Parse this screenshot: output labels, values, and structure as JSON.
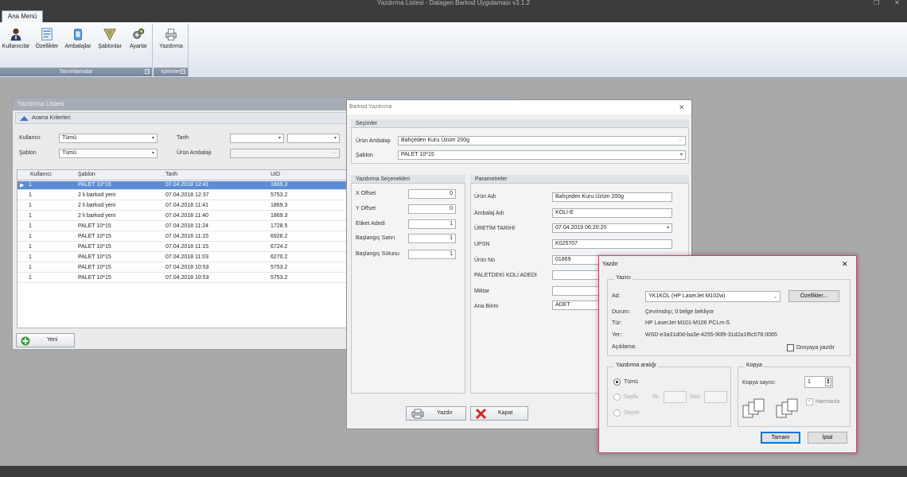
{
  "window": {
    "title": "Yazdırma Listesi - Datagen Barkod Uygulaması v3.1.2"
  },
  "ribbon": {
    "tab": "Ana Menü",
    "groups": [
      {
        "label": "Tanımlamalar",
        "buttons": [
          "Kullanıcılar",
          "Özellikler",
          "Ambalajlar",
          "Şablonlar",
          "Ayarlar"
        ]
      },
      {
        "label": "İşlemler",
        "buttons": [
          "Yazdırma"
        ]
      }
    ]
  },
  "list_window": {
    "title": "Yazdırma Listesi",
    "search_header": "Arama Kriterleri",
    "filters": {
      "kullanici_label": "Kullanıcı",
      "kullanici_value": "Tümü",
      "sablon_label": "Şablon",
      "sablon_value": "Tümü",
      "tarih_label": "Tarih",
      "urun_ambalaji_label": "Ürün Ambalajı"
    },
    "columns": [
      "Kullanıcı",
      "Şablon",
      "Tarih",
      "UID"
    ],
    "rows": [
      [
        "1",
        "PALET 10*15",
        "07.04.2018 12:41",
        "1869.3"
      ],
      [
        "1",
        "2 li barkod yeni",
        "07.04.2018 12:37",
        "5753.2"
      ],
      [
        "1",
        "2 li barkod yeni",
        "07.04.2018 11:41",
        "1869.3"
      ],
      [
        "1",
        "2 li barkod yeni",
        "07.04.2018 11:40",
        "1869.3"
      ],
      [
        "1",
        "PALET 10*15",
        "07.04.2018 11:24",
        "1728.5"
      ],
      [
        "1",
        "PALET 10*15",
        "07.04.2018 11:15",
        "6928.2"
      ],
      [
        "1",
        "PALET 10*15",
        "07.04.2018 11:15",
        "6724.2"
      ],
      [
        "1",
        "PALET 10*15",
        "07.04.2018 11:03",
        "6270.2"
      ],
      [
        "1",
        "PALET 10*15",
        "07.04.2018 10:53",
        "5753.2"
      ],
      [
        "1",
        "PALET 10*15",
        "07.04.2018 10:53",
        "5753.2"
      ]
    ],
    "new_button": "Yeni"
  },
  "barkod_window": {
    "title": "Barkod Yazdırma",
    "secimler": {
      "header": "Seçimler",
      "urun_ambalaji_label": "Ürün Ambalajı",
      "urun_ambalaji_value": "Bahçeden Kuru Üzüm 200g",
      "sablon_label": "Şablon",
      "sablon_value": "PALET 10*15"
    },
    "options": {
      "header": "Yazdırma Seçenekleri",
      "fields": [
        {
          "label": "X Offset",
          "value": "0"
        },
        {
          "label": "Y Offset",
          "value": "0"
        },
        {
          "label": "Etiket Adedi",
          "value": "1"
        },
        {
          "label": "Başlangıç Satırı",
          "value": "1"
        },
        {
          "label": "Başlangıç Sütunu",
          "value": "1"
        }
      ]
    },
    "params": {
      "header": "Parametreler",
      "fields": [
        {
          "label": "Ürün Adı",
          "value": "Bahçeden Kuru Üzüm 200g"
        },
        {
          "label": "Ambalaj Adı",
          "value": "KOLİ-E"
        },
        {
          "label": "ÜRETİM TARİHİ",
          "value": "07.04.2019 06:20:20"
        },
        {
          "label": "UPSN",
          "value": "K025707"
        },
        {
          "label": "Ürün No",
          "value": "01869"
        },
        {
          "label": "PALETDEKİ KOLİ ADEDİ",
          "value": ""
        },
        {
          "label": "Miktar",
          "value": ""
        },
        {
          "label": "Ana Birim",
          "value": "ADET"
        }
      ]
    },
    "print_button": "Yazdır",
    "close_button": "Kapat"
  },
  "print_dialog": {
    "title": "Yazdır",
    "close": "✕",
    "printer_group": "Yazıcı",
    "name_label": "Ad:",
    "name_value": "YK1KOL (HP LaserJet M102w)",
    "properties_button": "Özellikler...",
    "status_label": "Durum:",
    "status_value": "Çevrimdışı; 0 belge bekliyor",
    "type_label": "Tür:",
    "type_value": "HP LaserJet M101-M106 PCLm-S",
    "where_label": "Yer:",
    "where_value": "WSD-e3a31d0d-ba3e-4255-90f9-31d2a1f6c078.0065",
    "comment_label": "Açıklama:",
    "print_to_file": "Dosyaya yazdır",
    "range_group": "Yazdırma aralığı",
    "range_all": "Tümü",
    "range_pages": "Sayfa",
    "from_label": "İlk:",
    "to_label": "Son:",
    "range_selection": "Seçim",
    "copies_group": "Kopya",
    "copies_label": "Kopya sayısı:",
    "copies_value": "1",
    "collate": "Harmanla",
    "ok_button": "Tamam",
    "cancel_button": "İptal"
  }
}
